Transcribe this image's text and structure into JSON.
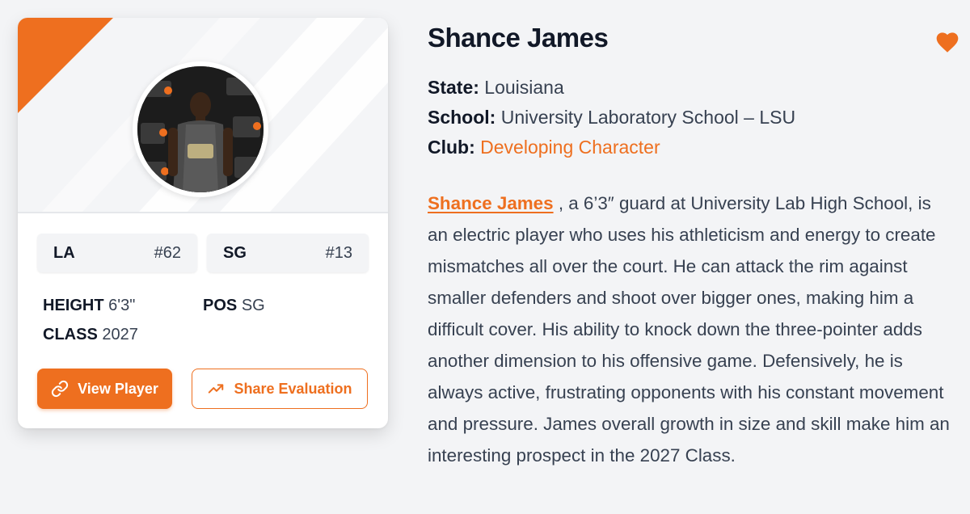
{
  "card": {
    "avatar_alt": "Shance James",
    "rankings": [
      {
        "label": "LA",
        "rank": "#62"
      },
      {
        "label": "SG",
        "rank": "#13"
      }
    ],
    "stats": {
      "height_label": "HEIGHT",
      "height_value": "6'3\"",
      "pos_label": "POS",
      "pos_value": "SG",
      "class_label": "CLASS",
      "class_value": "2027"
    },
    "buttons": {
      "view_player": "View Player",
      "share_evaluation": "Share Evaluation"
    },
    "icons": {
      "view_player": "link-icon",
      "share_evaluation": "trending-up-icon"
    },
    "colors": {
      "accent": "#ee6f1f",
      "banner_bg": "#f4f5f7"
    }
  },
  "detail": {
    "name": "Shance James",
    "favorite_icon": "heart-icon",
    "state_label": "State:",
    "state_value": "Louisiana",
    "school_label": "School:",
    "school_value": "University Laboratory School – LSU",
    "club_label": "Club:",
    "club_value": "Developing Character",
    "bio_name_link": "Shance James",
    "bio_text": " , a 6’3″ guard at University Lab High School, is an electric player who uses his athleticism and energy to create mismatches all over the court. He can attack the rim against smaller defenders and shoot over bigger ones, making him a difficult cover. His ability to knock down the three-pointer adds another dimension to his offensive game. Defensively, he is always active, frustrating opponents with his constant movement and pressure. James overall growth in size and skill make him an interesting prospect in the 2027 Class."
  }
}
